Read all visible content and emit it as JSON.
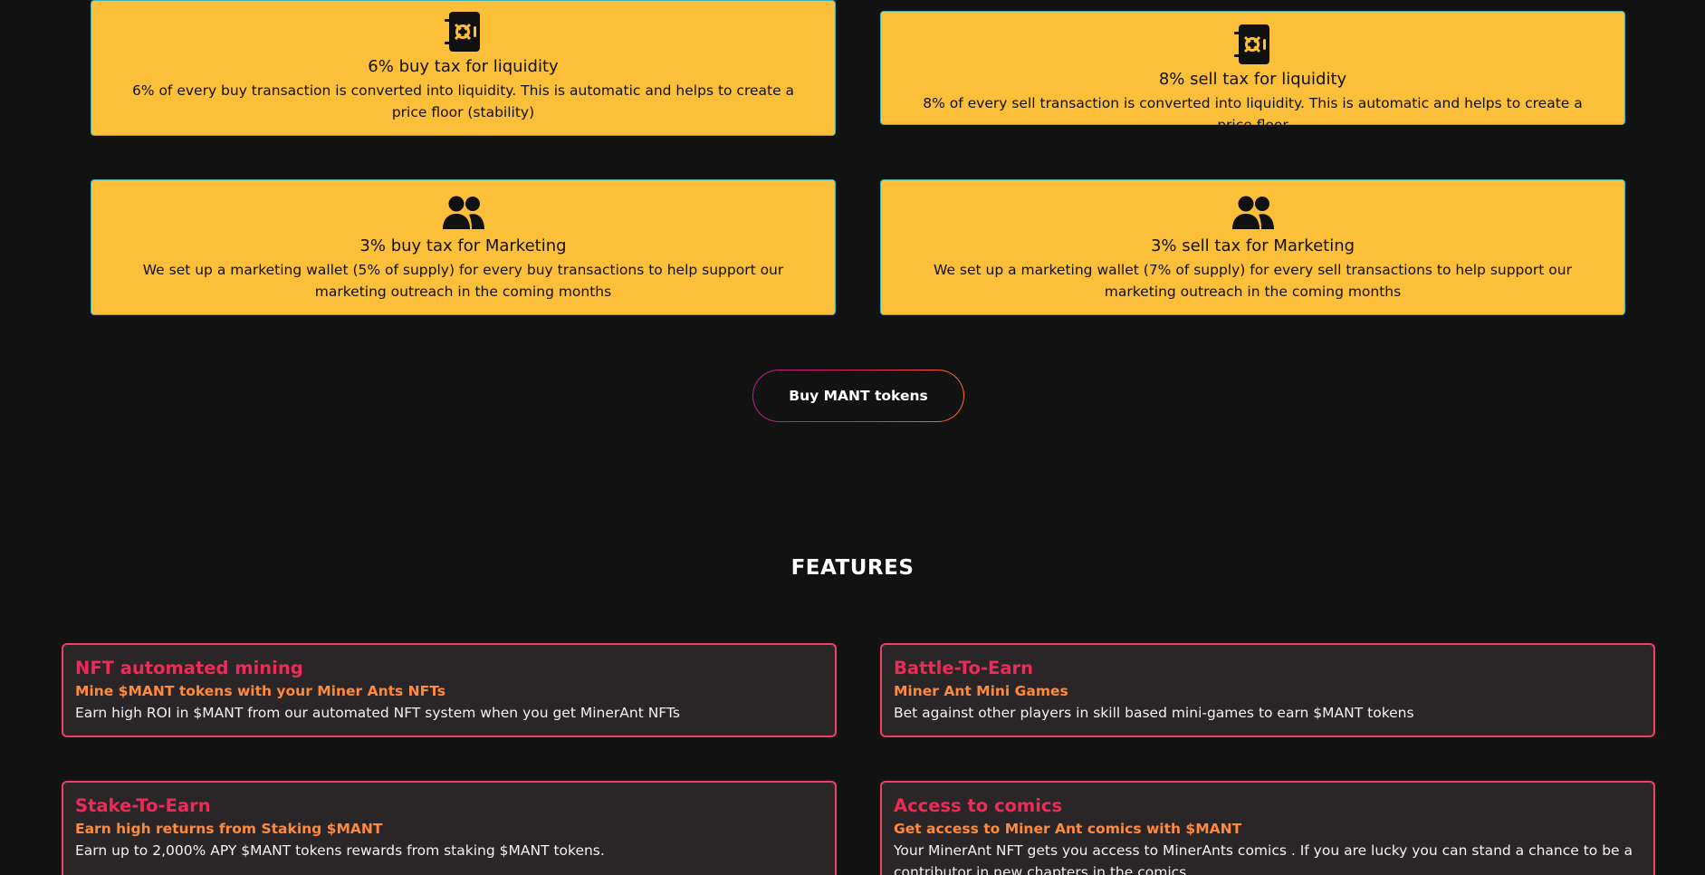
{
  "taxes": [
    {
      "title": "6% buy tax for liquidity",
      "desc": "6% of every buy transaction is converted into liquidity. This is automatic and helps to create a price floor (stability)",
      "icon": "safe-icon"
    },
    {
      "title": "8% sell tax for liquidity",
      "desc": "8% of every sell transaction is converted into liquidity. This is automatic and helps to create a price floor",
      "icon": "safe-icon"
    },
    {
      "title": "3% buy tax for Marketing",
      "desc": "We set up a marketing wallet (5% of supply) for every buy transactions to help support our marketing outreach in the coming months",
      "icon": "users-icon"
    },
    {
      "title": "3% sell tax for Marketing",
      "desc": "We set up a marketing wallet (7% of supply) for every sell transactions to help support our marketing outreach in the coming months",
      "icon": "users-icon"
    }
  ],
  "buy_button": {
    "label": "Buy MANT tokens"
  },
  "features_heading": "FEATURES",
  "features": [
    {
      "title": "NFT automated mining",
      "subtitle": "Mine $MANT tokens with your Miner Ants NFTs",
      "desc": "Earn high ROI in $MANT from our automated NFT system when you get MinerAnt NFTs"
    },
    {
      "title": "Battle-To-Earn",
      "subtitle": "Miner Ant Mini Games",
      "desc": "Bet against other players in skill based mini-games to earn $MANT tokens"
    },
    {
      "title": "Stake-To-Earn",
      "subtitle": "Earn high returns from Staking $MANT",
      "desc": "Earn up to 2,000% APY $MANT tokens rewards from staking $MANT tokens."
    },
    {
      "title": "Access to comics",
      "subtitle": "Get access to Miner Ant comics with $MANT",
      "desc": "Your MinerAnt NFT gets you access to MinerAnts comics . If you are lucky you can stand a chance to be a contributor in new chapters in the comics"
    }
  ],
  "colors": {
    "background": "#121212",
    "tax_card": "#fbbf3a",
    "feature_card": "#2a2526",
    "feature_border": "#ef3e6a",
    "feature_title": "#ee2b56",
    "feature_subtitle": "#ff8a3d"
  }
}
